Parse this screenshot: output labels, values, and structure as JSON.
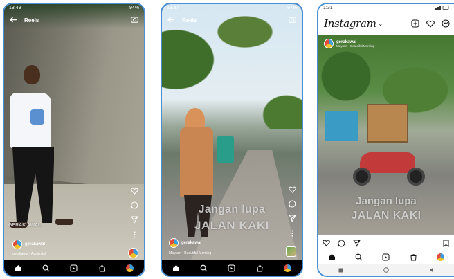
{
  "phones": [
    {
      "status_time": "13.49",
      "status_right": "94%",
      "header_title": "Reels",
      "watermark": "GERAK AWAL",
      "username": "gerakawal",
      "audio": "gerakawal • Audio Asli"
    },
    {
      "status_time": "13.37",
      "status_right": "97%",
      "header_title": "Reels",
      "overlay_line1": "Jangan lupa",
      "overlay_line2": "JALAN KAKI",
      "username": "gerakawal",
      "audio": "Mayrain • Beautiful Morning"
    },
    {
      "status_time": "1:31",
      "app_title": "Instagram",
      "username": "gerakawal",
      "user_sub": "Mayrain • Beautiful Morning",
      "overlay_line1": "Jangan lupa",
      "overlay_line2": "JALAN KAKI"
    }
  ],
  "colors": {
    "phone_border": "#4a8fd6",
    "overlay_text": "#e1e1e1"
  },
  "icons": {
    "back": "back-arrow-icon",
    "camera": "camera-icon",
    "like": "heart-icon",
    "comment": "comment-icon",
    "share": "send-icon",
    "more": "more-vertical-icon",
    "home": "home-icon",
    "search": "search-icon",
    "reels": "reels-icon",
    "shop": "shop-icon",
    "profile": "profile-icon",
    "add": "add-post-icon",
    "messenger": "messenger-icon",
    "save": "bookmark-icon"
  }
}
